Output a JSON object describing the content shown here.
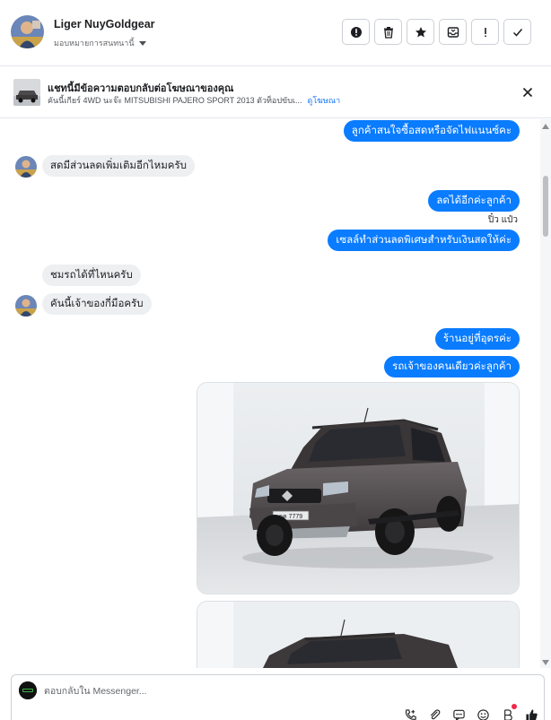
{
  "header": {
    "user_name": "Liger NuyGoldgear",
    "assign_label": "มอบหมายการสนทนานี้",
    "actions": [
      {
        "icon": "alert-circle-icon",
        "label": "report"
      },
      {
        "icon": "trash-icon",
        "label": "delete"
      },
      {
        "icon": "star-icon",
        "label": "star"
      },
      {
        "icon": "archive-icon",
        "label": "archive"
      },
      {
        "icon": "exclamation-icon",
        "label": "spam"
      },
      {
        "icon": "checkmark-icon",
        "label": "done"
      }
    ]
  },
  "ad_banner": {
    "title": "แชทนี้มีข้อความตอบกลับต่อโฆษณาของคุณ",
    "description": "คันนี้เกียร์ 4WD นะจ๊ะ MITSUBISHI PAJERO SPORT 2013 ตัวท็อปขับเ...",
    "link": "ดูโฆษณา"
  },
  "messages": [
    {
      "dir": "out",
      "text": "ลูกค้าสนใจซื้อสดหรือจัดไฟแนนซ์คะ"
    },
    {
      "dir": "in",
      "text": "สดมีส่วนลดเพิ่มเติมอีกไหมครับ"
    },
    {
      "dir": "out",
      "text": "ลดได้อีกค่ะลูกค้า"
    },
    {
      "dir": "sender",
      "text": "ปิ๋ว แป๋ว"
    },
    {
      "dir": "out",
      "text": "เซลล์ทำส่วนลดพิเศษสำหรับเงินสดให้ค่ะ"
    },
    {
      "dir": "in",
      "text": "ชมรถได้ที่ไหนครับ"
    },
    {
      "dir": "in",
      "text": "คันนี้เจ้าของกี่มือครับ"
    },
    {
      "dir": "out",
      "text": "ร้านอยู่ที่อุดรค่ะ"
    },
    {
      "dir": "out",
      "text": "รถเจ้าของคนเดียวค่ะลูกค้า"
    }
  ],
  "photos": [
    {
      "subject": "car-photo",
      "plate_text": "กค 7779"
    },
    {
      "subject": "car-photo-2"
    }
  ],
  "composer": {
    "placeholder": "ตอบกลับใน Messenger...",
    "tools": [
      "call-icon",
      "attach-icon",
      "saved-reply-icon",
      "emoji-icon",
      "payment-icon",
      "like-icon"
    ]
  },
  "colors": {
    "outgoing_bubble": "#0a7cff",
    "incoming_bubble": "#eeeff1",
    "link": "#1877f2",
    "notification_dot": "#f02849"
  }
}
